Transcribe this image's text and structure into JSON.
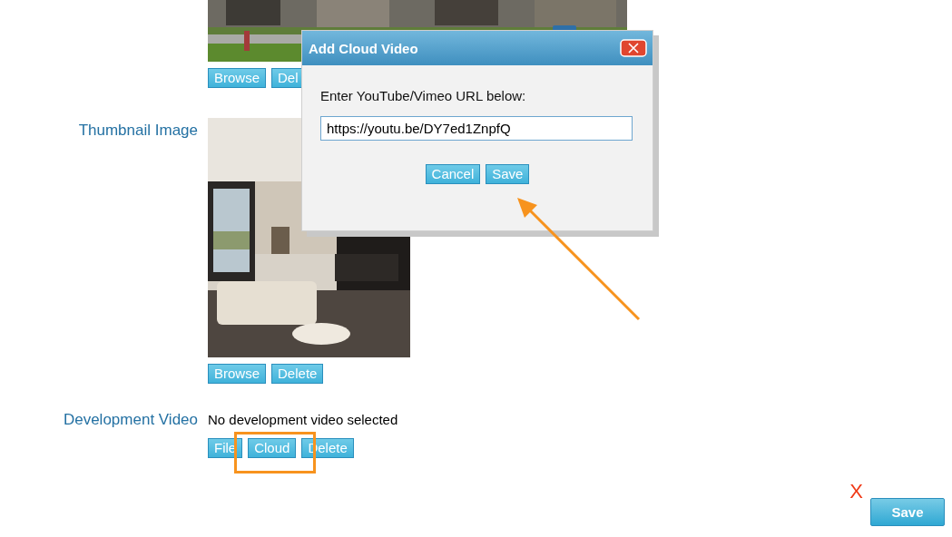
{
  "top_image": {
    "buttons": [
      "Browse",
      "Del"
    ]
  },
  "fields": [
    {
      "label": "Thumbnail Image",
      "buttons": [
        "Browse",
        "Delete"
      ]
    },
    {
      "label": "Development Video",
      "kind": "video",
      "status": "No development video selected",
      "buttons": [
        "File",
        "Cloud",
        "Delete"
      ]
    }
  ],
  "footer": {
    "cancel": "X",
    "save": "Save"
  },
  "dialog": {
    "title": "Add Cloud Video",
    "prompt": "Enter YouTube/Vimeo URL below:",
    "url": "https://youtu.be/DY7ed1ZnpfQ",
    "buttons": [
      "Cancel",
      "Save"
    ]
  }
}
